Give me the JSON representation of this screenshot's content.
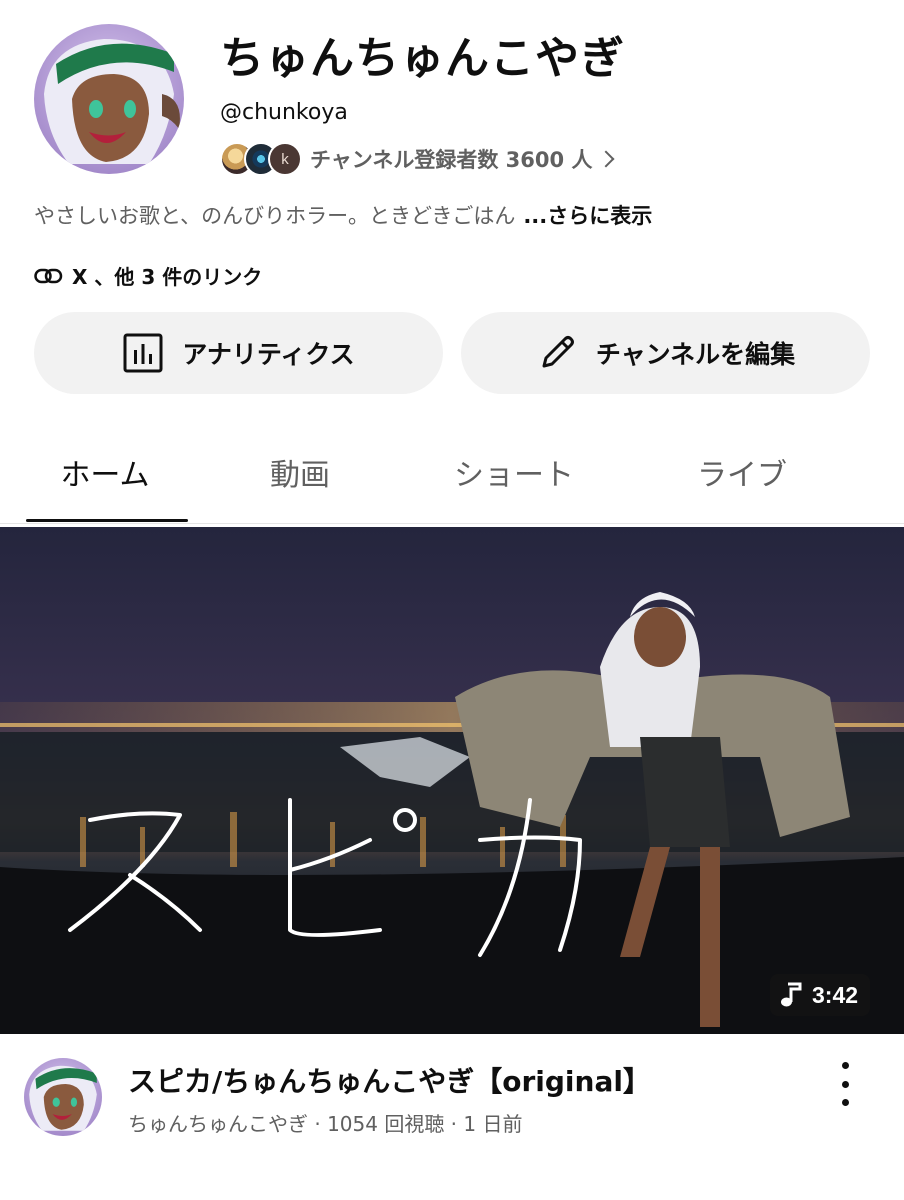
{
  "channel": {
    "name": "ちゅんちゅんこやぎ",
    "handle": "@chunkoya",
    "subscriber_text": "チャンネル登録者数 3600 人",
    "subscriber_avatar_k": "k",
    "description": "やさしいお歌と、のんびりホラー。ときどきごはん",
    "more_label": "...さらに表示",
    "links_text": "X 、他 3 件のリンク"
  },
  "actions": {
    "analytics_label": "アナリティクス",
    "edit_label": "チャンネルを編集"
  },
  "tabs": [
    {
      "label": "ホーム",
      "active": true
    },
    {
      "label": "動画",
      "active": false
    },
    {
      "label": "ショート",
      "active": false
    },
    {
      "label": "ライブ",
      "active": false
    }
  ],
  "featured_video": {
    "thumbnail_text": "スピカ",
    "duration": "3:42",
    "title": "スピカ/ちゅんちゅんこやぎ【original】",
    "meta": "ちゅんちゅんこやぎ · 1054 回視聴 · 1 日前"
  },
  "icons": {
    "link": "link-icon",
    "analytics": "bar-chart-icon",
    "edit": "pencil-icon",
    "music": "music-note-icon",
    "more": "more-vert-icon",
    "chevron": "chevron-right-icon"
  }
}
